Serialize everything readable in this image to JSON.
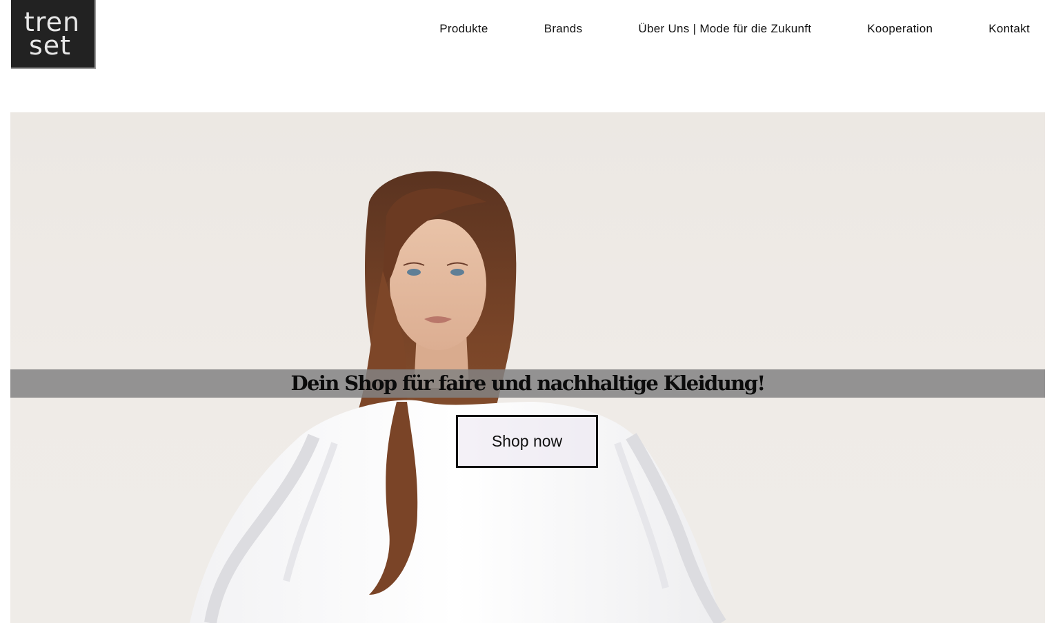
{
  "logo": {
    "line1": "tren",
    "line2": "set"
  },
  "nav": {
    "items": [
      {
        "label": "Produkte"
      },
      {
        "label": "Brands"
      },
      {
        "label": "Über Uns | Mode für die Zukunft"
      },
      {
        "label": "Kooperation"
      },
      {
        "label": "Kontakt"
      }
    ]
  },
  "hero": {
    "headline": "Dein Shop für faire und nachhaltige Kleidung!",
    "cta_label": "Shop now"
  }
}
